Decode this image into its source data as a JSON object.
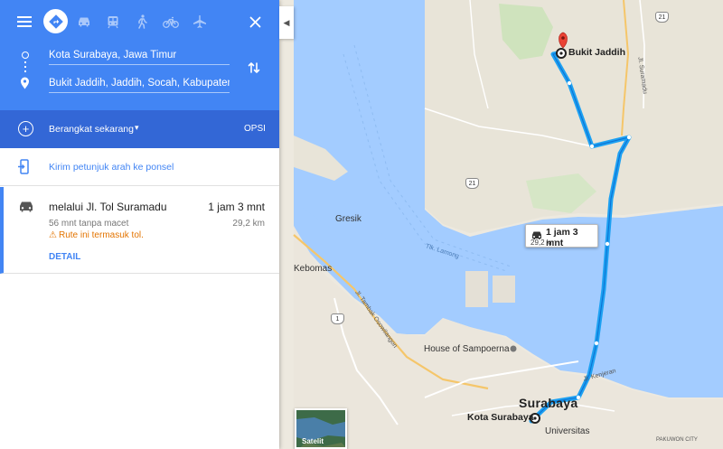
{
  "modes": {
    "menu_icon": "menu-icon",
    "active": "directions-icon",
    "items": [
      "car-icon",
      "transit-icon",
      "walk-icon",
      "bike-icon",
      "flight-icon"
    ],
    "close_icon": "close-icon"
  },
  "route": {
    "from": "Kota Surabaya, Jawa Timur",
    "to": "Bukit Jaddih, Jaddih, Socah, Kabupaten"
  },
  "depart": {
    "label": "Berangkat sekarang",
    "options": "OPSI"
  },
  "send": {
    "label": "Kirim petunjuk arah ke ponsel"
  },
  "result": {
    "name": "melalui Jl. Tol Suramadu",
    "time": "1 jam 3 mnt",
    "traffic": "56 mnt tanpa macet",
    "distance": "29,2 km",
    "toll_note": "Rute ini termasuk tol.",
    "detail": "DETAIL"
  },
  "map": {
    "route_info_time": "1 jam 3 mnt",
    "route_info_distance": "29,2 km",
    "destination": "Bukit Jaddih",
    "origin": "Kota Surabaya",
    "city": "Surabaya",
    "gresik": "Gresik",
    "kebomas": "Kebomas",
    "house": "House of Sampoerna",
    "universitas": "Universitas",
    "pakuwon": "PAKUWON CITY",
    "lamong": "Tlk. Lamong",
    "road1": "Jl. Tambak Osowilangon",
    "road2": "Jl. Suramadu",
    "road3": "Jl. Kenjeran",
    "road_21a": "21",
    "road_21b": "21",
    "road_1": "1",
    "satellite": "Satelit",
    "colors": {
      "water": "#a3ccff",
      "land": "#ede9df",
      "route": "#1da1f2",
      "panel_header": "#4285f4",
      "depart_bar": "#3367d6"
    }
  }
}
